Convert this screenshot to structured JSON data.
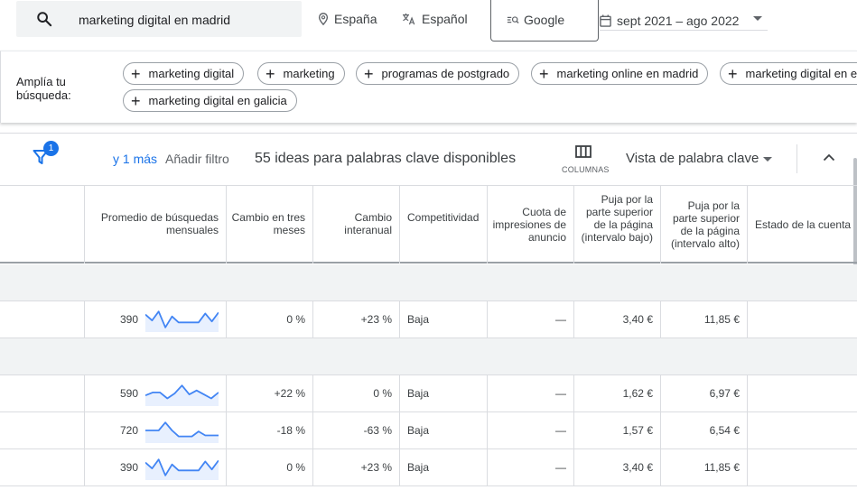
{
  "topbar": {
    "search_query": "marketing digital en madrid",
    "location": "España",
    "language": "Español",
    "network": "Google",
    "date_range": "sept 2021 – ago 2022"
  },
  "broaden": {
    "title": "Amplía tu búsqueda:",
    "chips": [
      "marketing digital",
      "marketing",
      "programas de postgrado",
      "marketing online en madrid",
      "marketing digital en e",
      "marketing digital en galicia"
    ]
  },
  "toolbar": {
    "filter_count": "1",
    "more_link": "y 1 más",
    "add_filter": "Añadir filtro",
    "ideas_count": "55 ideas para palabras clave disponibles",
    "columns_label": "COLUMNAS",
    "view_label": "Vista de palabra clave"
  },
  "table": {
    "headers": [
      "",
      "Promedio de búsquedas mensuales",
      "Cambio en tres meses",
      "Cambio interanual",
      "Competitividad",
      "Cuota de impresiones de anuncio",
      "Puja por la parte superior de la página (intervalo bajo)",
      "Puja por la parte superior de la página (intervalo alto)",
      "Estado de la cuenta"
    ],
    "rows": [
      {
        "group": true
      },
      {
        "searches": "390",
        "trend": [
          0.75,
          0.45,
          0.9,
          0.1,
          0.65,
          0.35,
          0.35,
          0.35,
          0.35,
          0.8,
          0.4,
          0.85
        ],
        "three_month": "0 %",
        "yoy": "+23 %",
        "competition": "Baja",
        "impr_share": "—",
        "bid_low": "3,40 €",
        "bid_high": "11,85 €"
      },
      {
        "group": true
      },
      {
        "searches": "590",
        "trend": [
          0.4,
          0.55,
          0.55,
          0.25,
          0.5,
          0.9,
          0.45,
          0.65,
          0.45,
          0.25,
          0.55
        ],
        "three_month": "+22 %",
        "yoy": "0 %",
        "competition": "Baja",
        "impr_share": "—",
        "bid_low": "1,62 €",
        "bid_high": "6,97 €"
      },
      {
        "searches": "720",
        "trend": [
          0.5,
          0.5,
          0.5,
          0.9,
          0.5,
          0.2,
          0.2,
          0.2,
          0.45,
          0.25,
          0.25,
          0.25
        ],
        "three_month": "-18 %",
        "yoy": "-63 %",
        "competition": "Baja",
        "impr_share": "—",
        "bid_low": "1,57 €",
        "bid_high": "6,54 €"
      },
      {
        "searches": "390",
        "trend": [
          0.75,
          0.45,
          0.9,
          0.1,
          0.65,
          0.35,
          0.35,
          0.35,
          0.35,
          0.8,
          0.4,
          0.85
        ],
        "three_month": "0 %",
        "yoy": "+23 %",
        "competition": "Baja",
        "impr_share": "—",
        "bid_low": "3,40 €",
        "bid_high": "11,85 €"
      }
    ]
  },
  "colors": {
    "accent": "#1a73e8",
    "spark_line": "#4285f4",
    "spark_fill": "#e8f0fe",
    "group_row": "#f1f3f4"
  }
}
